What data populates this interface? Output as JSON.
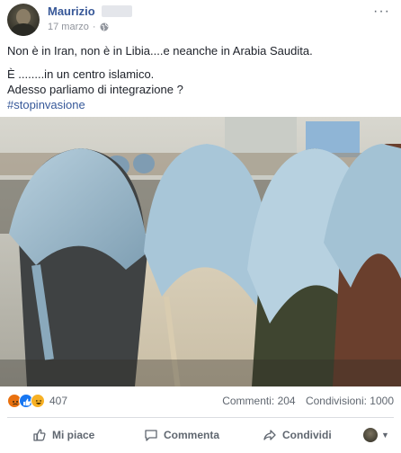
{
  "post": {
    "author": "Maurizio",
    "date": "17 marzo",
    "separator": "·",
    "menu_label": "···",
    "lines": [
      "Non è in Iran, non è in Libia....e neanche in Arabia Saudita.",
      "È ........in un centro islamico.",
      "Adesso parliamo di integrazione ?"
    ],
    "hashtag": "#stopinvasione"
  },
  "icons": {
    "audience": "globe-icon",
    "menu": "more-options-icon",
    "reactions": [
      "angry-reaction-icon",
      "like-reaction-icon",
      "haha-reaction-icon"
    ],
    "like": "thumbs-up-icon",
    "comment": "speech-bubble-icon",
    "share": "share-arrow-icon"
  },
  "engagement": {
    "reactions_count": "407",
    "comments": "Commenti: 204",
    "shares": "Condivisioni: 1000"
  },
  "actions": {
    "like": "Mi piace",
    "comment": "Commenta",
    "share": "Condividi"
  },
  "colors": {
    "link": "#385898",
    "muted": "#606770",
    "like_blue": "#1877f2",
    "angry_orange": "#e9710f",
    "haha_yellow": "#f7b125"
  }
}
